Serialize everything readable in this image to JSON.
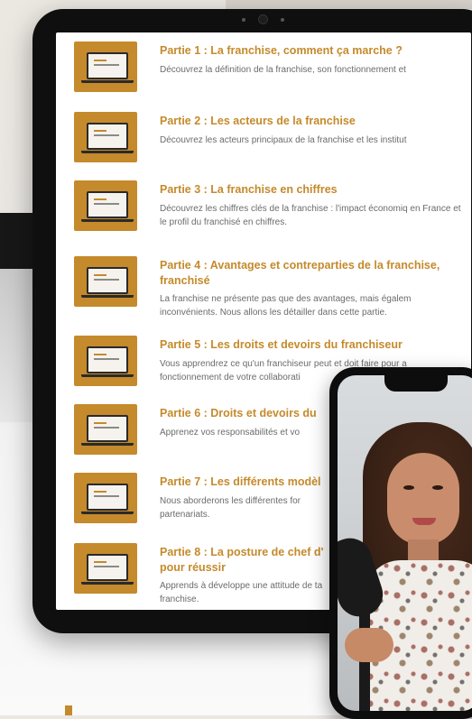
{
  "modules": [
    {
      "title": "Partie 1 : La franchise, comment ça marche ?",
      "desc": "Découvrez la définition de la franchise, son fonctionnement et"
    },
    {
      "title": "Partie 2 : Les acteurs de la franchise",
      "desc": "Découvrez les acteurs principaux de la franchise et les institut"
    },
    {
      "title": "Partie 3 : La franchise en chiffres",
      "desc": "Découvrez les chiffres clés de la franchise : l'impact économiq en France et le profil du franchisé en chiffres."
    },
    {
      "title": "Partie 4 : Avantages et contreparties de la franchise, franchisé",
      "desc": "La franchise ne présente pas que des avantages, mais égalem inconvénients. Nous allons les détailler dans cette partie."
    },
    {
      "title": "Partie 5 : Les droits et devoirs du franchiseur",
      "desc": "Vous apprendrez ce qu'un franchiseur peut et doit faire pour a fonctionnement de votre collaborati"
    },
    {
      "title": "Partie 6 : Droits et devoirs du",
      "desc": "Apprenez vos responsabilités et vo"
    },
    {
      "title": "Partie 7 : Les différents modèl",
      "desc": "Nous aborderons les différentes for partenariats."
    },
    {
      "title": "Partie 8 : La posture de chef d' pour réussir",
      "desc": "Apprends à développe une attitude de ta franchise."
    }
  ],
  "colors": {
    "accent": "#c58a2b",
    "text_muted": "#6b6b6b",
    "device": "#0f0f10"
  },
  "icons": {
    "thumbnail": "laptop-thumbnail-icon"
  }
}
